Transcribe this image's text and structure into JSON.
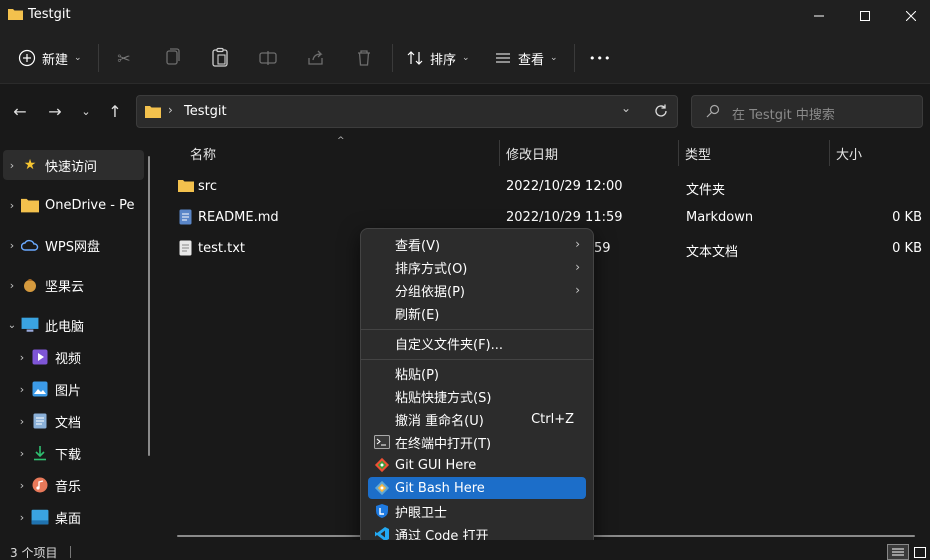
{
  "window": {
    "title": "Testgit"
  },
  "toolbar": {
    "new_label": "新建",
    "sort_label": "排序",
    "view_label": "查看",
    "more_label": "•••"
  },
  "address": {
    "path": "Testgit",
    "search_placeholder": "在 Testgit 中搜索"
  },
  "sidebar": {
    "items": [
      {
        "label": "快速访问",
        "icon": "star-icon"
      },
      {
        "label": "OneDrive - Pers",
        "icon": "folder-icon"
      },
      {
        "label": "WPS网盘",
        "icon": "cloud-icon"
      },
      {
        "label": "坚果云",
        "icon": "nut-icon"
      },
      {
        "label": "此电脑",
        "icon": "monitor-icon"
      },
      {
        "label": "视频",
        "icon": "video-icon"
      },
      {
        "label": "图片",
        "icon": "image-icon"
      },
      {
        "label": "文档",
        "icon": "document-icon"
      },
      {
        "label": "下载",
        "icon": "download-icon"
      },
      {
        "label": "音乐",
        "icon": "music-icon"
      },
      {
        "label": "桌面",
        "icon": "desktop-icon"
      }
    ]
  },
  "list": {
    "columns": {
      "name": "名称",
      "modified": "修改日期",
      "type": "类型",
      "size": "大小"
    },
    "rows": [
      {
        "name": "src",
        "modified": "2022/10/29 12:00",
        "type": "文件夹",
        "size": ""
      },
      {
        "name": "README.md",
        "modified": "2022/10/29 11:59",
        "type": "Markdown",
        "size": "0 KB"
      },
      {
        "name": "test.txt",
        "modified": "59",
        "type": "文本文档",
        "size": "0 KB"
      }
    ]
  },
  "context_menu": {
    "items": [
      {
        "label": "查看(V)"
      },
      {
        "label": "排序方式(O)"
      },
      {
        "label": "分组依据(P)"
      },
      {
        "label": "刷新(E)"
      },
      {
        "label": "自定义文件夹(F)..."
      },
      {
        "label": "粘贴(P)"
      },
      {
        "label": "粘贴快捷方式(S)"
      },
      {
        "label": "撤消 重命名(U)",
        "shortcut": "Ctrl+Z"
      },
      {
        "label": "在终端中打开(T)"
      },
      {
        "label": "Git GUI Here"
      },
      {
        "label": "Git Bash Here"
      },
      {
        "label": "护眼卫士"
      },
      {
        "label": "通过 Code 打开"
      }
    ]
  },
  "status": {
    "count": "3 个项目"
  },
  "colors": {
    "highlight": "#1c6ec9",
    "folder": "#f3c14d",
    "background": "#191919"
  }
}
